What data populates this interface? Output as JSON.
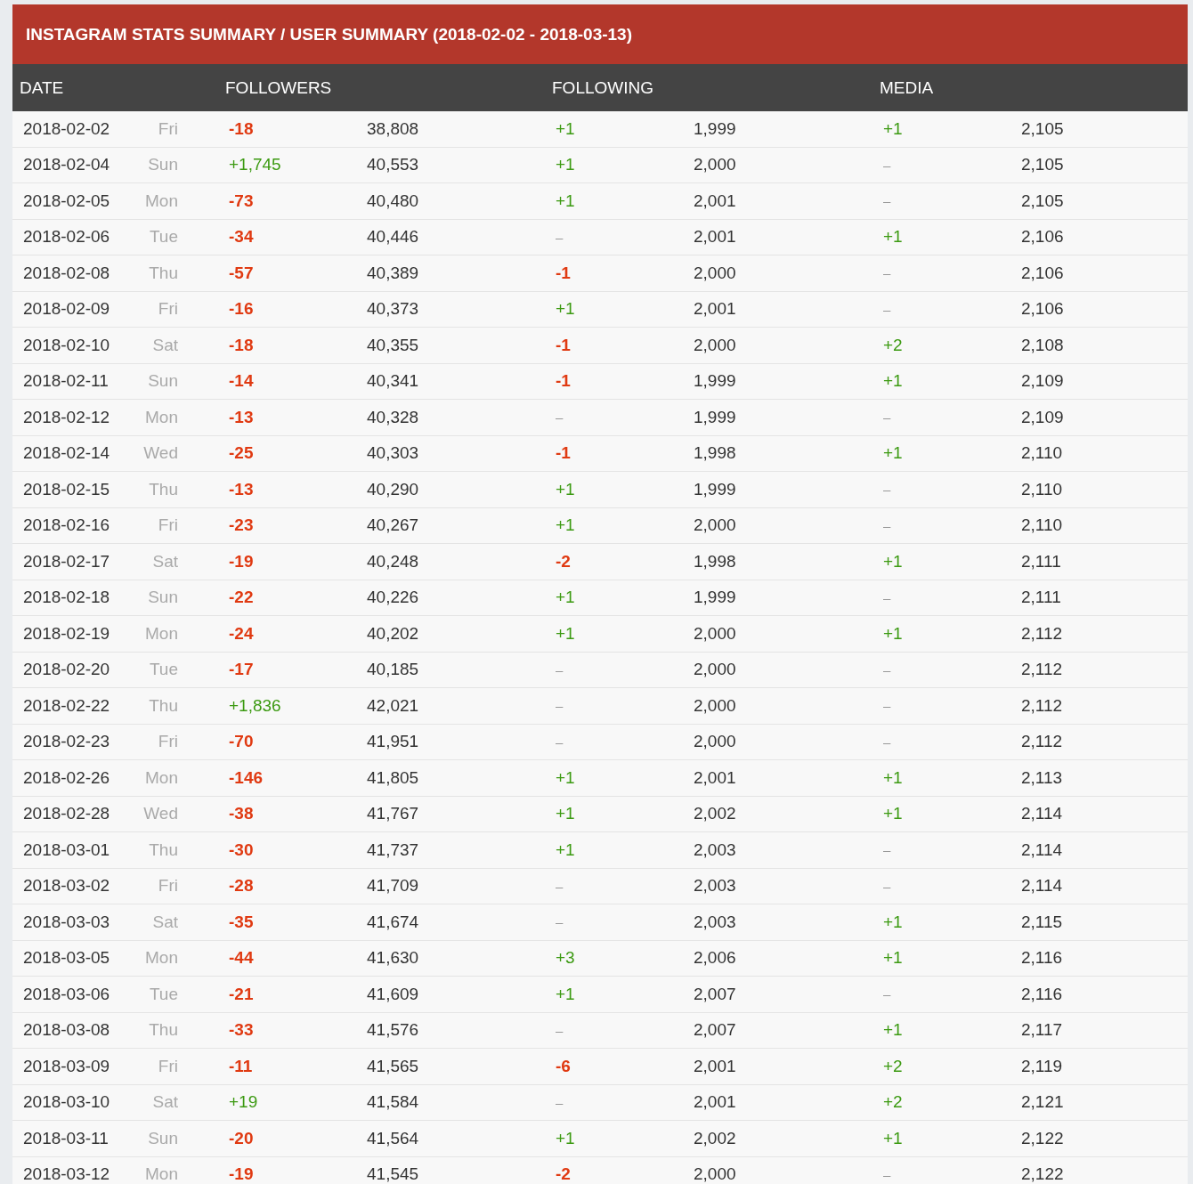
{
  "title": "INSTAGRAM STATS SUMMARY / USER SUMMARY (2018-02-02 - 2018-03-13)",
  "columns": [
    "DATE",
    "FOLLOWERS",
    "FOLLOWING",
    "MEDIA"
  ],
  "rows": [
    {
      "date": "2018-02-02",
      "day": "Fri",
      "followers": {
        "change": "-18",
        "kind": "down",
        "total": "38,808"
      },
      "following": {
        "change": "+1",
        "kind": "up",
        "total": "1,999"
      },
      "media": {
        "change": "+1",
        "kind": "up",
        "total": "2,105"
      }
    },
    {
      "date": "2018-02-04",
      "day": "Sun",
      "followers": {
        "change": "+1,745",
        "kind": "up",
        "total": "40,553"
      },
      "following": {
        "change": "+1",
        "kind": "up",
        "total": "2,000"
      },
      "media": {
        "change": "–",
        "kind": "none",
        "total": "2,105"
      }
    },
    {
      "date": "2018-02-05",
      "day": "Mon",
      "followers": {
        "change": "-73",
        "kind": "down",
        "total": "40,480"
      },
      "following": {
        "change": "+1",
        "kind": "up",
        "total": "2,001"
      },
      "media": {
        "change": "–",
        "kind": "none",
        "total": "2,105"
      }
    },
    {
      "date": "2018-02-06",
      "day": "Tue",
      "followers": {
        "change": "-34",
        "kind": "down",
        "total": "40,446"
      },
      "following": {
        "change": "–",
        "kind": "none",
        "total": "2,001"
      },
      "media": {
        "change": "+1",
        "kind": "up",
        "total": "2,106"
      }
    },
    {
      "date": "2018-02-08",
      "day": "Thu",
      "followers": {
        "change": "-57",
        "kind": "down",
        "total": "40,389"
      },
      "following": {
        "change": "-1",
        "kind": "down",
        "total": "2,000"
      },
      "media": {
        "change": "–",
        "kind": "none",
        "total": "2,106"
      }
    },
    {
      "date": "2018-02-09",
      "day": "Fri",
      "followers": {
        "change": "-16",
        "kind": "down",
        "total": "40,373"
      },
      "following": {
        "change": "+1",
        "kind": "up",
        "total": "2,001"
      },
      "media": {
        "change": "–",
        "kind": "none",
        "total": "2,106"
      }
    },
    {
      "date": "2018-02-10",
      "day": "Sat",
      "followers": {
        "change": "-18",
        "kind": "down",
        "total": "40,355"
      },
      "following": {
        "change": "-1",
        "kind": "down",
        "total": "2,000"
      },
      "media": {
        "change": "+2",
        "kind": "up",
        "total": "2,108"
      }
    },
    {
      "date": "2018-02-11",
      "day": "Sun",
      "followers": {
        "change": "-14",
        "kind": "down",
        "total": "40,341"
      },
      "following": {
        "change": "-1",
        "kind": "down",
        "total": "1,999"
      },
      "media": {
        "change": "+1",
        "kind": "up",
        "total": "2,109"
      }
    },
    {
      "date": "2018-02-12",
      "day": "Mon",
      "followers": {
        "change": "-13",
        "kind": "down",
        "total": "40,328"
      },
      "following": {
        "change": "–",
        "kind": "none",
        "total": "1,999"
      },
      "media": {
        "change": "–",
        "kind": "none",
        "total": "2,109"
      }
    },
    {
      "date": "2018-02-14",
      "day": "Wed",
      "followers": {
        "change": "-25",
        "kind": "down",
        "total": "40,303"
      },
      "following": {
        "change": "-1",
        "kind": "down",
        "total": "1,998"
      },
      "media": {
        "change": "+1",
        "kind": "up",
        "total": "2,110"
      }
    },
    {
      "date": "2018-02-15",
      "day": "Thu",
      "followers": {
        "change": "-13",
        "kind": "down",
        "total": "40,290"
      },
      "following": {
        "change": "+1",
        "kind": "up",
        "total": "1,999"
      },
      "media": {
        "change": "–",
        "kind": "none",
        "total": "2,110"
      }
    },
    {
      "date": "2018-02-16",
      "day": "Fri",
      "followers": {
        "change": "-23",
        "kind": "down",
        "total": "40,267"
      },
      "following": {
        "change": "+1",
        "kind": "up",
        "total": "2,000"
      },
      "media": {
        "change": "–",
        "kind": "none",
        "total": "2,110"
      }
    },
    {
      "date": "2018-02-17",
      "day": "Sat",
      "followers": {
        "change": "-19",
        "kind": "down",
        "total": "40,248"
      },
      "following": {
        "change": "-2",
        "kind": "down",
        "total": "1,998"
      },
      "media": {
        "change": "+1",
        "kind": "up",
        "total": "2,111"
      }
    },
    {
      "date": "2018-02-18",
      "day": "Sun",
      "followers": {
        "change": "-22",
        "kind": "down",
        "total": "40,226"
      },
      "following": {
        "change": "+1",
        "kind": "up",
        "total": "1,999"
      },
      "media": {
        "change": "–",
        "kind": "none",
        "total": "2,111"
      }
    },
    {
      "date": "2018-02-19",
      "day": "Mon",
      "followers": {
        "change": "-24",
        "kind": "down",
        "total": "40,202"
      },
      "following": {
        "change": "+1",
        "kind": "up",
        "total": "2,000"
      },
      "media": {
        "change": "+1",
        "kind": "up",
        "total": "2,112"
      }
    },
    {
      "date": "2018-02-20",
      "day": "Tue",
      "followers": {
        "change": "-17",
        "kind": "down",
        "total": "40,185"
      },
      "following": {
        "change": "–",
        "kind": "none",
        "total": "2,000"
      },
      "media": {
        "change": "–",
        "kind": "none",
        "total": "2,112"
      }
    },
    {
      "date": "2018-02-22",
      "day": "Thu",
      "followers": {
        "change": "+1,836",
        "kind": "up",
        "total": "42,021"
      },
      "following": {
        "change": "–",
        "kind": "none",
        "total": "2,000"
      },
      "media": {
        "change": "–",
        "kind": "none",
        "total": "2,112"
      }
    },
    {
      "date": "2018-02-23",
      "day": "Fri",
      "followers": {
        "change": "-70",
        "kind": "down",
        "total": "41,951"
      },
      "following": {
        "change": "–",
        "kind": "none",
        "total": "2,000"
      },
      "media": {
        "change": "–",
        "kind": "none",
        "total": "2,112"
      }
    },
    {
      "date": "2018-02-26",
      "day": "Mon",
      "followers": {
        "change": "-146",
        "kind": "down",
        "total": "41,805"
      },
      "following": {
        "change": "+1",
        "kind": "up",
        "total": "2,001"
      },
      "media": {
        "change": "+1",
        "kind": "up",
        "total": "2,113"
      }
    },
    {
      "date": "2018-02-28",
      "day": "Wed",
      "followers": {
        "change": "-38",
        "kind": "down",
        "total": "41,767"
      },
      "following": {
        "change": "+1",
        "kind": "up",
        "total": "2,002"
      },
      "media": {
        "change": "+1",
        "kind": "up",
        "total": "2,114"
      }
    },
    {
      "date": "2018-03-01",
      "day": "Thu",
      "followers": {
        "change": "-30",
        "kind": "down",
        "total": "41,737"
      },
      "following": {
        "change": "+1",
        "kind": "up",
        "total": "2,003"
      },
      "media": {
        "change": "–",
        "kind": "none",
        "total": "2,114"
      }
    },
    {
      "date": "2018-03-02",
      "day": "Fri",
      "followers": {
        "change": "-28",
        "kind": "down",
        "total": "41,709"
      },
      "following": {
        "change": "–",
        "kind": "none",
        "total": "2,003"
      },
      "media": {
        "change": "–",
        "kind": "none",
        "total": "2,114"
      }
    },
    {
      "date": "2018-03-03",
      "day": "Sat",
      "followers": {
        "change": "-35",
        "kind": "down",
        "total": "41,674"
      },
      "following": {
        "change": "–",
        "kind": "none",
        "total": "2,003"
      },
      "media": {
        "change": "+1",
        "kind": "up",
        "total": "2,115"
      }
    },
    {
      "date": "2018-03-05",
      "day": "Mon",
      "followers": {
        "change": "-44",
        "kind": "down",
        "total": "41,630"
      },
      "following": {
        "change": "+3",
        "kind": "up",
        "total": "2,006"
      },
      "media": {
        "change": "+1",
        "kind": "up",
        "total": "2,116"
      }
    },
    {
      "date": "2018-03-06",
      "day": "Tue",
      "followers": {
        "change": "-21",
        "kind": "down",
        "total": "41,609"
      },
      "following": {
        "change": "+1",
        "kind": "up",
        "total": "2,007"
      },
      "media": {
        "change": "–",
        "kind": "none",
        "total": "2,116"
      }
    },
    {
      "date": "2018-03-08",
      "day": "Thu",
      "followers": {
        "change": "-33",
        "kind": "down",
        "total": "41,576"
      },
      "following": {
        "change": "–",
        "kind": "none",
        "total": "2,007"
      },
      "media": {
        "change": "+1",
        "kind": "up",
        "total": "2,117"
      }
    },
    {
      "date": "2018-03-09",
      "day": "Fri",
      "followers": {
        "change": "-11",
        "kind": "down",
        "total": "41,565"
      },
      "following": {
        "change": "-6",
        "kind": "down",
        "total": "2,001"
      },
      "media": {
        "change": "+2",
        "kind": "up",
        "total": "2,119"
      }
    },
    {
      "date": "2018-03-10",
      "day": "Sat",
      "followers": {
        "change": "+19",
        "kind": "up",
        "total": "41,584"
      },
      "following": {
        "change": "–",
        "kind": "none",
        "total": "2,001"
      },
      "media": {
        "change": "+2",
        "kind": "up",
        "total": "2,121"
      }
    },
    {
      "date": "2018-03-11",
      "day": "Sun",
      "followers": {
        "change": "-20",
        "kind": "down",
        "total": "41,564"
      },
      "following": {
        "change": "+1",
        "kind": "up",
        "total": "2,002"
      },
      "media": {
        "change": "+1",
        "kind": "up",
        "total": "2,122"
      }
    },
    {
      "date": "2018-03-12",
      "day": "Mon",
      "followers": {
        "change": "-19",
        "kind": "down",
        "total": "41,545"
      },
      "following": {
        "change": "-2",
        "kind": "down",
        "total": "2,000"
      },
      "media": {
        "change": "–",
        "kind": "none",
        "total": "2,122"
      }
    }
  ]
}
